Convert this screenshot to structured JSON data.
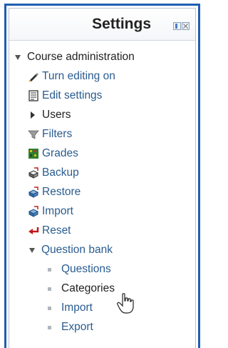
{
  "block": {
    "title": "Settings",
    "header_icons": [
      "dock-icon",
      "close-icon"
    ]
  },
  "tree": {
    "course_admin": "Course administration",
    "turn_editing": "Turn editing on",
    "edit_settings": "Edit settings",
    "users": "Users",
    "filters": "Filters",
    "grades": "Grades",
    "backup": "Backup",
    "restore": "Restore",
    "import": "Import",
    "reset": "Reset",
    "question_bank": "Question bank",
    "qb_items": [
      "Questions",
      "Categories",
      "Import",
      "Export"
    ]
  },
  "icons": {
    "turn_editing": "pencil-icon",
    "edit_settings": "document-icon",
    "filters": "funnel-icon",
    "grades": "grades-table-icon",
    "backup": "backup-icon",
    "restore": "restore-icon",
    "import": "import-icon",
    "reset": "reset-arrow-icon"
  },
  "colors": {
    "accent_border": "#1f5fb0",
    "link": "#2a5c8f",
    "text": "#222222"
  }
}
